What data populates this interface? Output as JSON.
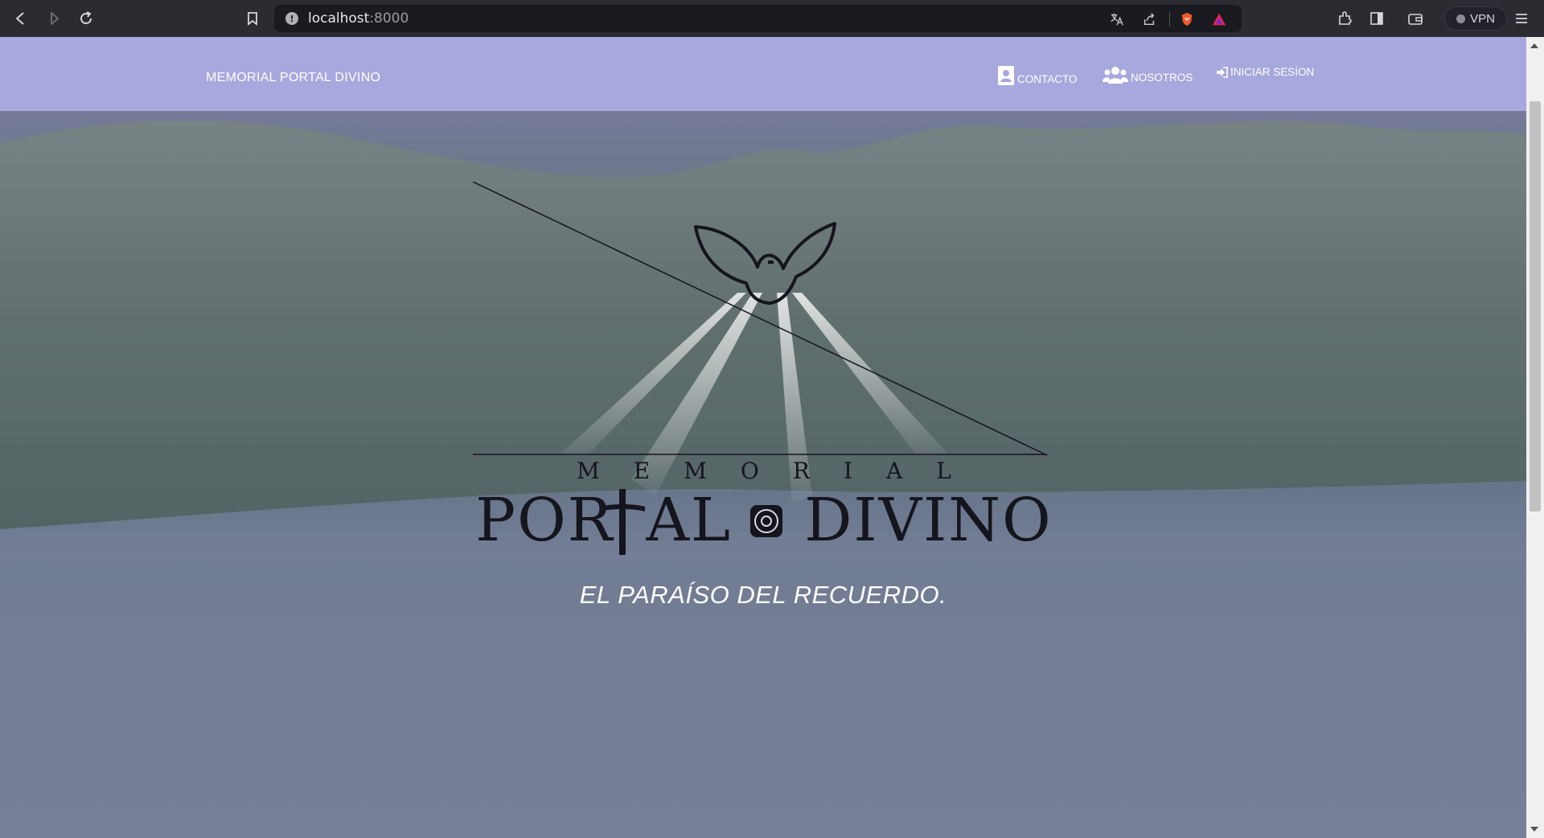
{
  "browser": {
    "url_host": "localhost",
    "url_port": ":8000",
    "vpn_label": "VPN"
  },
  "site": {
    "brand": "MEMORIAL PORTAL DIVINO",
    "nav": {
      "contact": "CONTACTO",
      "about": "NOSOTROS",
      "login": "INICIAR SESÍON"
    },
    "logo": {
      "top_word": "MEMORIAL",
      "main_word_left": "POR",
      "main_word_mid": "AL",
      "main_word_right": "DIVINO"
    },
    "tagline": "EL PARAÍSO DEL RECUERDO."
  },
  "colors": {
    "nav_bg": "#a7a8dd",
    "chrome_bg": "#2b2c31",
    "logo_ink": "#15151d"
  }
}
